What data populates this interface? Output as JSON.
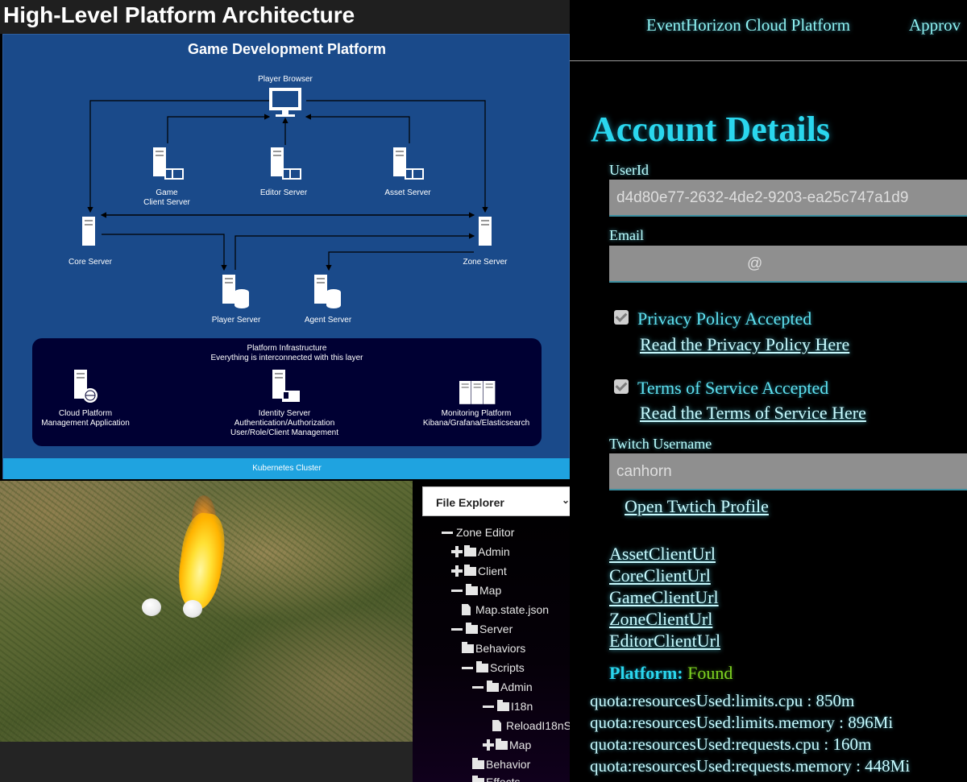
{
  "architecture": {
    "heading": "High-Level Platform Architecture",
    "diagram_title": "Game Development Platform",
    "nodes": {
      "player_browser": "Player Browser",
      "game_client_server_1": "Game",
      "game_client_server_2": "Client Server",
      "editor_server": "Editor Server",
      "asset_server": "Asset Server",
      "core_server": "Core Server",
      "zone_server": "Zone Server",
      "player_server": "Player Server",
      "agent_server": "Agent Server"
    },
    "infrastructure": {
      "title": "Platform Infrastructure",
      "subtitle": "Everything is interconnected with this layer",
      "cloud_1": "Cloud Platform",
      "cloud_2": "Management Application",
      "identity_1": "Identity Server",
      "identity_2": "Authentication/Authorization",
      "identity_3": "User/Role/Client Management",
      "monitoring_1": "Monitoring Platform",
      "monitoring_2": "Kibana/Grafana/Elasticsearch"
    },
    "kubernetes": "Kubernetes Cluster"
  },
  "explorer": {
    "selected": "File Explorer",
    "tree": [
      {
        "label": "Zone Editor",
        "kind": "minus-folderless"
      },
      {
        "label": "Admin",
        "kind": "plus-folder"
      },
      {
        "label": "Client",
        "kind": "plus-folder"
      },
      {
        "label": "Map",
        "kind": "minus-folder"
      },
      {
        "label": "Map.state.json",
        "kind": "file"
      },
      {
        "label": "Server",
        "kind": "minus-folder"
      },
      {
        "label": "Behaviors",
        "kind": "folder"
      },
      {
        "label": "Scripts",
        "kind": "minus-folder"
      },
      {
        "label": "Admin",
        "kind": "minus-folder"
      },
      {
        "label": "I18n",
        "kind": "minus-folder"
      },
      {
        "label": "ReloadI18nS",
        "kind": "file"
      },
      {
        "label": "Map",
        "kind": "plus-folder"
      },
      {
        "label": "Behavior",
        "kind": "folder"
      },
      {
        "label": "Effects",
        "kind": "folder"
      }
    ]
  },
  "nav": {
    "brand": "EventHorizon Cloud Platform",
    "second": "Approv"
  },
  "account": {
    "title": "Account Details",
    "userid_label": "UserId",
    "userid_value": "d4d80e77-2632-4de2-9203-ea25c747a1d9",
    "email_label": "Email",
    "email_value": "@",
    "privacy_label": "Privacy Policy Accepted",
    "privacy_link": "Read the Privacy Policy Here",
    "tos_label": "Terms of Service Accepted",
    "tos_link": "Read the Terms of Service Here",
    "twitch_label": "Twitch Username",
    "twitch_value": "canhorn",
    "twitch_link": "Open Twtich Profile",
    "client_urls": [
      "AssetClientUrl",
      "CoreClientUrl",
      "GameClientUrl",
      "ZoneClientUrl",
      "EditorClientUrl"
    ],
    "platform_key": "Platform:",
    "platform_value": "Found",
    "quotas": [
      "quota:resourcesUsed:limits.cpu : 850m",
      "quota:resourcesUsed:limits.memory : 896Mi",
      "quota:resourcesUsed:requests.cpu : 160m",
      "quota:resourcesUsed:requests.memory : 448Mi"
    ]
  },
  "colors": {
    "diagram_bg": "#1a4a8a",
    "infra_bg": "#000033",
    "kubernetes_bar": "#1fa3e0",
    "accent_cyan": "#2ad7ee",
    "found_green": "#7ed321"
  }
}
